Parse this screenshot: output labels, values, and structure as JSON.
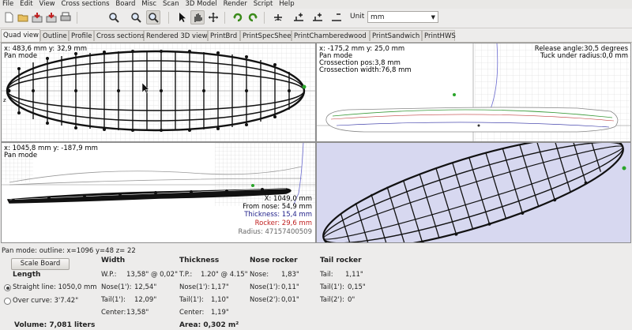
{
  "menu": [
    "File",
    "Edit",
    "View",
    "Cross sections",
    "Board",
    "Misc",
    "Scan",
    "3D Model",
    "Render",
    "Script",
    "Help"
  ],
  "toolbar": {
    "icons": [
      "new-icon",
      "open-icon",
      "save-icon",
      "save-as-icon",
      "print-icon",
      "zoom-icon",
      "zoom-in-icon",
      "zoom-out-icon",
      "arrow-icon",
      "pan-icon",
      "move-icon",
      "rotate-left-icon",
      "rotate-right-icon",
      "add-point-icon",
      "add-cross-section-icon",
      "delete-cross-section-icon",
      "guide-icon"
    ],
    "unit_label": "Unit",
    "unit_value": "mm"
  },
  "tabs": [
    "Quad view",
    "Outline",
    "Profile",
    "Cross sections",
    "Rendered 3D view",
    "PrintBrd",
    "PrintSpecSheet",
    "PrintChamberedwood",
    "PrintSandwich",
    "PrintHWS"
  ],
  "views": {
    "outline": {
      "coords": "x: 483,6 mm y:   32,9 mm",
      "mode": "Pan mode",
      "label_z": "z"
    },
    "crosssection": {
      "coords": "x:  -175,2 mm y:  25,0 mm",
      "mode": "Pan mode",
      "pos": "Crossection pos:3,8 mm",
      "width": "Crossection width:76,8 mm",
      "release": "Release angle:30,5 degrees",
      "tuck": "Tuck under radius:0,0 mm"
    },
    "profile": {
      "coords": "x: 1045,8 mm y: -187,9 mm",
      "mode": "Pan mode",
      "pos_tail": "X: 1049,0 mm",
      "from_nose": "From nose: 54,9 mm",
      "thickness_label": "Thickness:",
      "thickness": "15,4 mm",
      "rocker_label": "Rocker:",
      "rocker": "29,6 mm",
      "radius": "Radius: 47157400509"
    },
    "render": {}
  },
  "status": "Pan mode: outline: x=1096 y=48 z= 22",
  "specs": {
    "scale_button": "Scale Board",
    "length_title": "Length",
    "straight_label": "Straight line: 1050,0 mm",
    "curve_label": "Over curve: 3'7.42\"",
    "volume": "Volume: 7,081 liters",
    "area": "Area: 0,302 m²",
    "width": {
      "title": "Width",
      "rows": [
        {
          "k": "W.P.:",
          "v": "13,58\" @ 0,02\""
        },
        {
          "k": "Nose(1'):",
          "v": "12,54\""
        },
        {
          "k": "Tail(1'):",
          "v": "12,09\""
        },
        {
          "k": "Center:",
          "v": "13,58\""
        }
      ]
    },
    "thickness": {
      "title": "Thickness",
      "rows": [
        {
          "k": "T.P.:",
          "v": "1.20\" @ 4.15\""
        },
        {
          "k": "Nose(1'):",
          "v": "1,17\""
        },
        {
          "k": "Tail(1'):",
          "v": "1,10\""
        },
        {
          "k": "Center:",
          "v": "1,19\""
        }
      ]
    },
    "nose_rocker": {
      "title": "Nose rocker",
      "rows": [
        {
          "k": "Nose:",
          "v": "1,83\""
        },
        {
          "k": "Nose(1'):",
          "v": "0,11\""
        },
        {
          "k": "Nose(2'):",
          "v": "0,01\""
        }
      ]
    },
    "tail_rocker": {
      "title": "Tail rocker",
      "rows": [
        {
          "k": "Tail:",
          "v": "1,11\""
        },
        {
          "k": "Tail(1'):",
          "v": "0,15\""
        },
        {
          "k": "Tail(2'):",
          "v": "0\""
        }
      ]
    }
  }
}
